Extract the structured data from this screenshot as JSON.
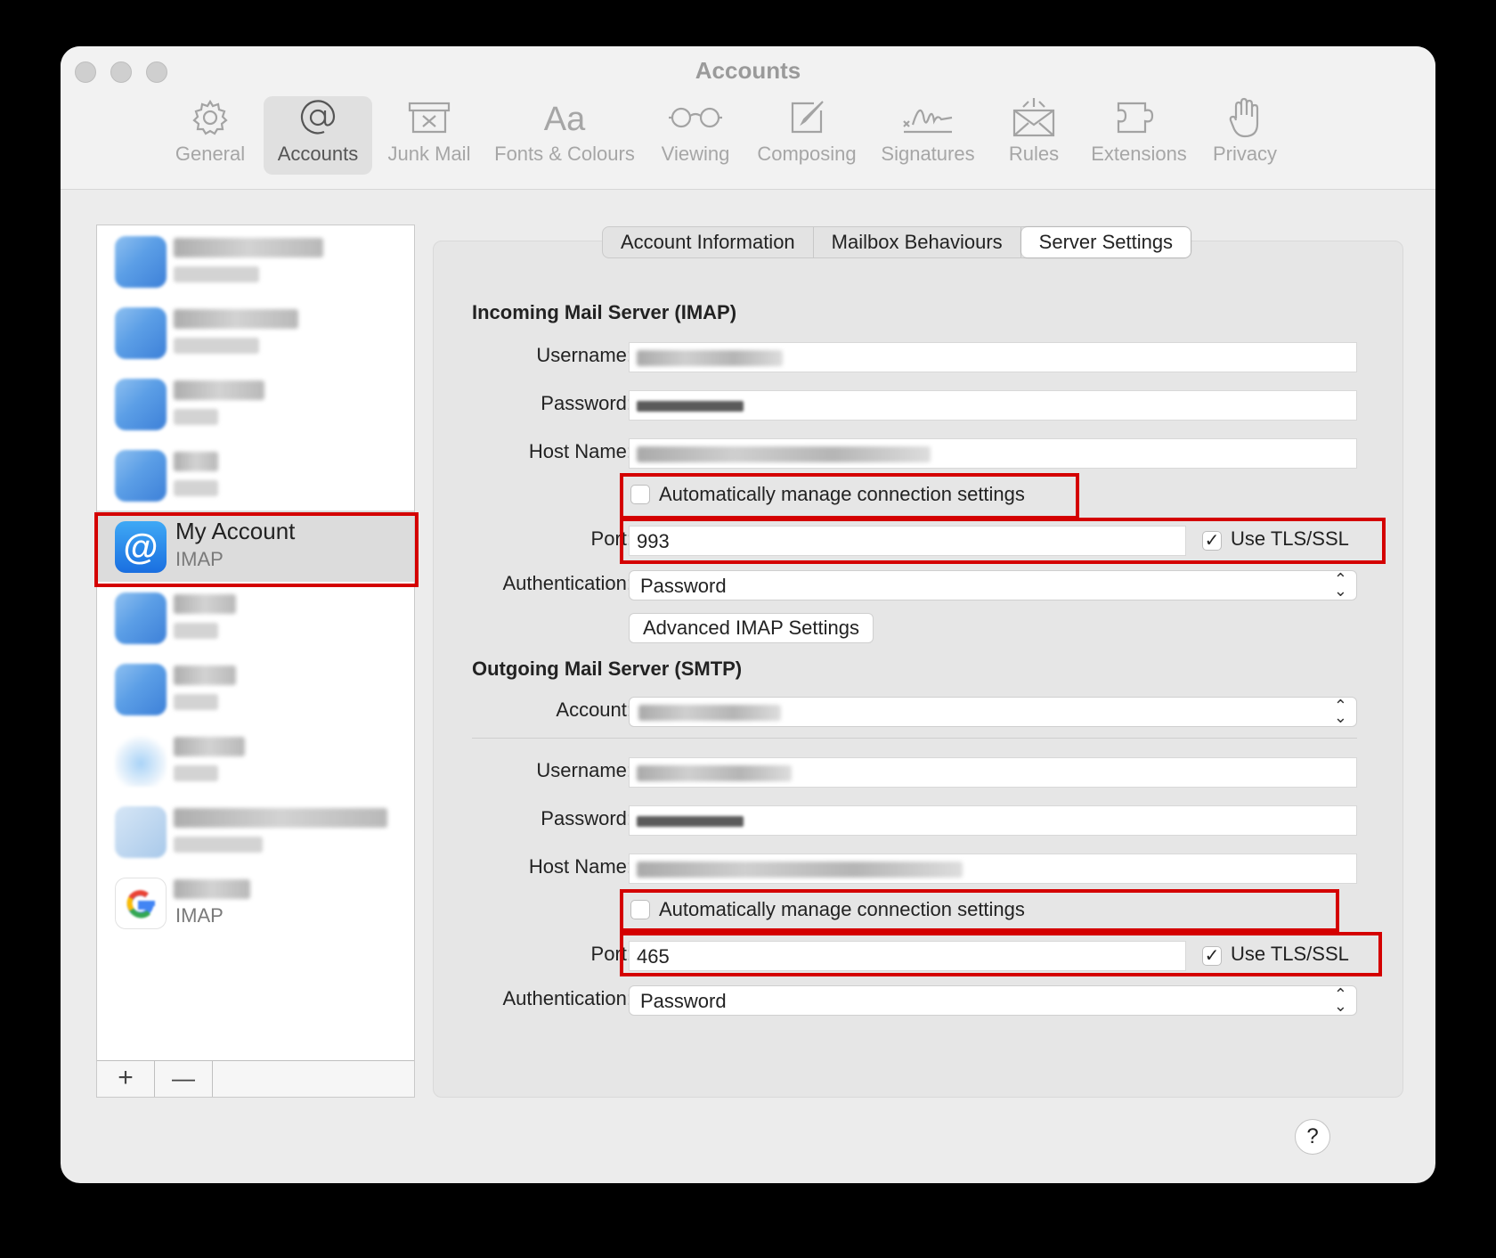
{
  "window": {
    "title": "Accounts"
  },
  "toolbar": {
    "items": [
      {
        "label": "General",
        "icon": "gear-icon"
      },
      {
        "label": "Accounts",
        "icon": "at-icon"
      },
      {
        "label": "Junk Mail",
        "icon": "junk-mail-icon"
      },
      {
        "label": "Fonts & Colours",
        "icon": "fonts-icon"
      },
      {
        "label": "Viewing",
        "icon": "glasses-icon"
      },
      {
        "label": "Composing",
        "icon": "compose-icon"
      },
      {
        "label": "Signatures",
        "icon": "signature-icon"
      },
      {
        "label": "Rules",
        "icon": "rules-icon"
      },
      {
        "label": "Extensions",
        "icon": "puzzle-icon"
      },
      {
        "label": "Privacy",
        "icon": "hand-icon"
      }
    ],
    "fonts_glyph": "Aa"
  },
  "sidebar": {
    "selected": {
      "name": "My Account",
      "type": "IMAP",
      "icon_glyph": "@"
    },
    "last_account_type": "IMAP",
    "add_label": "+",
    "remove_label": "—"
  },
  "tabs": [
    {
      "label": "Account Information",
      "active": false
    },
    {
      "label": "Mailbox Behaviours",
      "active": false
    },
    {
      "label": "Server Settings",
      "active": true
    }
  ],
  "incoming": {
    "heading": "Incoming Mail Server (IMAP)",
    "username_label": "Username:",
    "password_label": "Password:",
    "host_label": "Host Name:",
    "auto_manage_label": "Automatically manage connection settings",
    "auto_manage_checked": false,
    "port_label": "Port:",
    "port_value": "993",
    "tls_label": "Use TLS/SSL",
    "tls_checked": true,
    "tls_check_glyph": "✓",
    "auth_label": "Authentication:",
    "auth_value": "Password",
    "advanced_button": "Advanced IMAP Settings"
  },
  "outgoing": {
    "heading": "Outgoing Mail Server (SMTP)",
    "account_label": "Account:",
    "username_label": "Username:",
    "password_label": "Password:",
    "host_label": "Host Name:",
    "auto_manage_label": "Automatically manage connection settings",
    "auto_manage_checked": false,
    "port_label": "Port:",
    "port_value": "465",
    "tls_label": "Use TLS/SSL",
    "tls_checked": true,
    "tls_check_glyph": "✓",
    "auth_label": "Authentication:",
    "auth_value": "Password"
  },
  "help_label": "?",
  "colors": {
    "highlight_box": "#d40000",
    "selected_row": "#dcdcdc",
    "at_icon_top": "#3fa9f5",
    "at_icon_bottom": "#1a6fe0"
  }
}
